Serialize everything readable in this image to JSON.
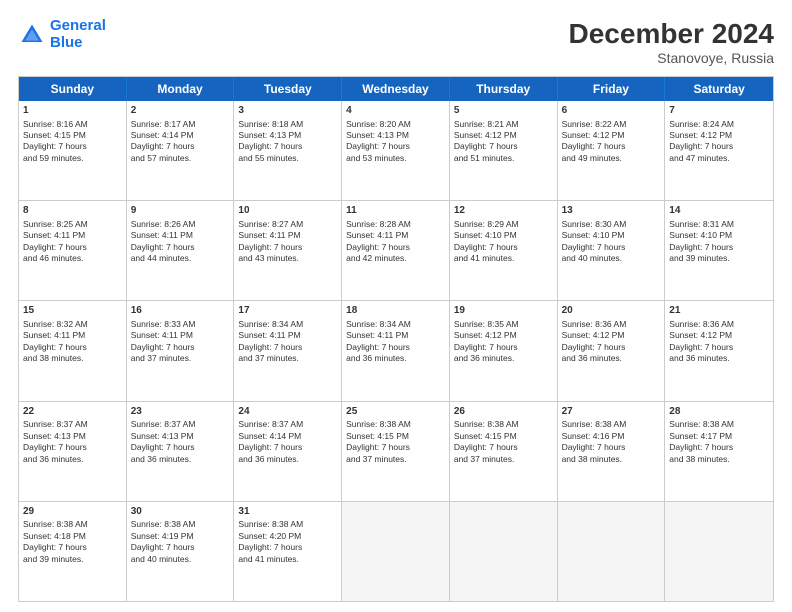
{
  "header": {
    "logo_line1": "General",
    "logo_line2": "Blue",
    "main_title": "December 2024",
    "subtitle": "Stanovoye, Russia"
  },
  "weekdays": [
    "Sunday",
    "Monday",
    "Tuesday",
    "Wednesday",
    "Thursday",
    "Friday",
    "Saturday"
  ],
  "weeks": [
    [
      {
        "day": "1",
        "lines": [
          "Sunrise: 8:16 AM",
          "Sunset: 4:15 PM",
          "Daylight: 7 hours",
          "and 59 minutes."
        ]
      },
      {
        "day": "2",
        "lines": [
          "Sunrise: 8:17 AM",
          "Sunset: 4:14 PM",
          "Daylight: 7 hours",
          "and 57 minutes."
        ]
      },
      {
        "day": "3",
        "lines": [
          "Sunrise: 8:18 AM",
          "Sunset: 4:13 PM",
          "Daylight: 7 hours",
          "and 55 minutes."
        ]
      },
      {
        "day": "4",
        "lines": [
          "Sunrise: 8:20 AM",
          "Sunset: 4:13 PM",
          "Daylight: 7 hours",
          "and 53 minutes."
        ]
      },
      {
        "day": "5",
        "lines": [
          "Sunrise: 8:21 AM",
          "Sunset: 4:12 PM",
          "Daylight: 7 hours",
          "and 51 minutes."
        ]
      },
      {
        "day": "6",
        "lines": [
          "Sunrise: 8:22 AM",
          "Sunset: 4:12 PM",
          "Daylight: 7 hours",
          "and 49 minutes."
        ]
      },
      {
        "day": "7",
        "lines": [
          "Sunrise: 8:24 AM",
          "Sunset: 4:12 PM",
          "Daylight: 7 hours",
          "and 47 minutes."
        ]
      }
    ],
    [
      {
        "day": "8",
        "lines": [
          "Sunrise: 8:25 AM",
          "Sunset: 4:11 PM",
          "Daylight: 7 hours",
          "and 46 minutes."
        ]
      },
      {
        "day": "9",
        "lines": [
          "Sunrise: 8:26 AM",
          "Sunset: 4:11 PM",
          "Daylight: 7 hours",
          "and 44 minutes."
        ]
      },
      {
        "day": "10",
        "lines": [
          "Sunrise: 8:27 AM",
          "Sunset: 4:11 PM",
          "Daylight: 7 hours",
          "and 43 minutes."
        ]
      },
      {
        "day": "11",
        "lines": [
          "Sunrise: 8:28 AM",
          "Sunset: 4:11 PM",
          "Daylight: 7 hours",
          "and 42 minutes."
        ]
      },
      {
        "day": "12",
        "lines": [
          "Sunrise: 8:29 AM",
          "Sunset: 4:10 PM",
          "Daylight: 7 hours",
          "and 41 minutes."
        ]
      },
      {
        "day": "13",
        "lines": [
          "Sunrise: 8:30 AM",
          "Sunset: 4:10 PM",
          "Daylight: 7 hours",
          "and 40 minutes."
        ]
      },
      {
        "day": "14",
        "lines": [
          "Sunrise: 8:31 AM",
          "Sunset: 4:10 PM",
          "Daylight: 7 hours",
          "and 39 minutes."
        ]
      }
    ],
    [
      {
        "day": "15",
        "lines": [
          "Sunrise: 8:32 AM",
          "Sunset: 4:11 PM",
          "Daylight: 7 hours",
          "and 38 minutes."
        ]
      },
      {
        "day": "16",
        "lines": [
          "Sunrise: 8:33 AM",
          "Sunset: 4:11 PM",
          "Daylight: 7 hours",
          "and 37 minutes."
        ]
      },
      {
        "day": "17",
        "lines": [
          "Sunrise: 8:34 AM",
          "Sunset: 4:11 PM",
          "Daylight: 7 hours",
          "and 37 minutes."
        ]
      },
      {
        "day": "18",
        "lines": [
          "Sunrise: 8:34 AM",
          "Sunset: 4:11 PM",
          "Daylight: 7 hours",
          "and 36 minutes."
        ]
      },
      {
        "day": "19",
        "lines": [
          "Sunrise: 8:35 AM",
          "Sunset: 4:12 PM",
          "Daylight: 7 hours",
          "and 36 minutes."
        ]
      },
      {
        "day": "20",
        "lines": [
          "Sunrise: 8:36 AM",
          "Sunset: 4:12 PM",
          "Daylight: 7 hours",
          "and 36 minutes."
        ]
      },
      {
        "day": "21",
        "lines": [
          "Sunrise: 8:36 AM",
          "Sunset: 4:12 PM",
          "Daylight: 7 hours",
          "and 36 minutes."
        ]
      }
    ],
    [
      {
        "day": "22",
        "lines": [
          "Sunrise: 8:37 AM",
          "Sunset: 4:13 PM",
          "Daylight: 7 hours",
          "and 36 minutes."
        ]
      },
      {
        "day": "23",
        "lines": [
          "Sunrise: 8:37 AM",
          "Sunset: 4:13 PM",
          "Daylight: 7 hours",
          "and 36 minutes."
        ]
      },
      {
        "day": "24",
        "lines": [
          "Sunrise: 8:37 AM",
          "Sunset: 4:14 PM",
          "Daylight: 7 hours",
          "and 36 minutes."
        ]
      },
      {
        "day": "25",
        "lines": [
          "Sunrise: 8:38 AM",
          "Sunset: 4:15 PM",
          "Daylight: 7 hours",
          "and 37 minutes."
        ]
      },
      {
        "day": "26",
        "lines": [
          "Sunrise: 8:38 AM",
          "Sunset: 4:15 PM",
          "Daylight: 7 hours",
          "and 37 minutes."
        ]
      },
      {
        "day": "27",
        "lines": [
          "Sunrise: 8:38 AM",
          "Sunset: 4:16 PM",
          "Daylight: 7 hours",
          "and 38 minutes."
        ]
      },
      {
        "day": "28",
        "lines": [
          "Sunrise: 8:38 AM",
          "Sunset: 4:17 PM",
          "Daylight: 7 hours",
          "and 38 minutes."
        ]
      }
    ],
    [
      {
        "day": "29",
        "lines": [
          "Sunrise: 8:38 AM",
          "Sunset: 4:18 PM",
          "Daylight: 7 hours",
          "and 39 minutes."
        ]
      },
      {
        "day": "30",
        "lines": [
          "Sunrise: 8:38 AM",
          "Sunset: 4:19 PM",
          "Daylight: 7 hours",
          "and 40 minutes."
        ]
      },
      {
        "day": "31",
        "lines": [
          "Sunrise: 8:38 AM",
          "Sunset: 4:20 PM",
          "Daylight: 7 hours",
          "and 41 minutes."
        ]
      },
      {
        "day": "",
        "lines": []
      },
      {
        "day": "",
        "lines": []
      },
      {
        "day": "",
        "lines": []
      },
      {
        "day": "",
        "lines": []
      }
    ]
  ]
}
